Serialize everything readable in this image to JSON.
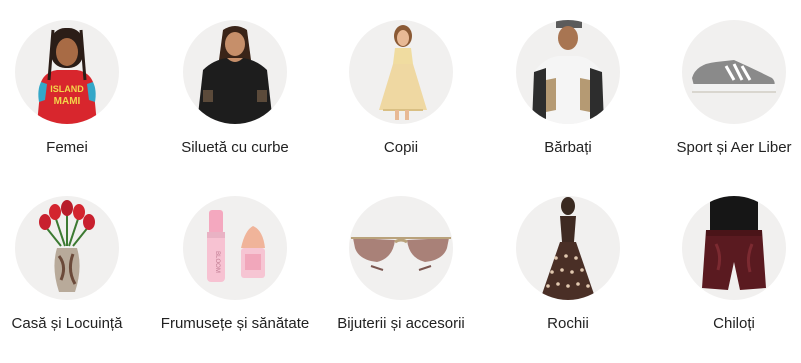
{
  "categories": [
    {
      "label": "Femei",
      "icon": "woman-in-red-top-icon"
    },
    {
      "label": "Siluetă cu curbe",
      "icon": "curvy-woman-black-top-icon"
    },
    {
      "label": "Copii",
      "icon": "girl-yellow-dress-icon"
    },
    {
      "label": "Bărbați",
      "icon": "man-white-shirt-icon"
    },
    {
      "label": "Sport și Aer Liber",
      "icon": "sneaker-icon"
    },
    {
      "label": "Casă și Locuință",
      "icon": "tulips-vase-icon"
    },
    {
      "label": "Frumusețe și sănătate",
      "icon": "lip-gloss-blender-icon"
    },
    {
      "label": "Bijuterii și accesorii",
      "icon": "sunglasses-icon"
    },
    {
      "label": "Rochii",
      "icon": "polka-dot-dress-icon"
    },
    {
      "label": "Chiloți",
      "icon": "leather-shorts-icon"
    }
  ]
}
